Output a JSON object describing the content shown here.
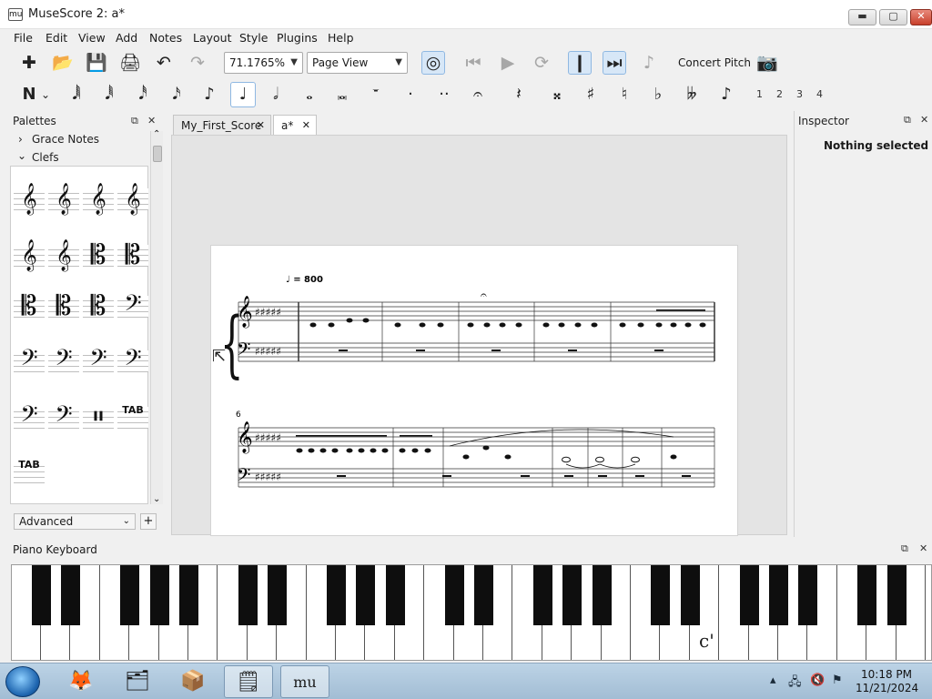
{
  "window": {
    "title": "MuseScore 2: a*",
    "app_icon": "mu",
    "controls": {
      "minimize": "▬",
      "maximize": "▢",
      "close": "✕"
    }
  },
  "menu": {
    "items": [
      "File",
      "Edit",
      "View",
      "Add",
      "Notes",
      "Layout",
      "Style",
      "Plugins",
      "Help"
    ]
  },
  "toolbar": {
    "zoom_value": "71.1765%",
    "view_mode": "Page View",
    "concert_pitch_label": "Concert Pitch",
    "icons": {
      "new_score": "✚",
      "open": "📂",
      "save": "💾",
      "print": "🖨",
      "undo": "↶",
      "redo": "↷",
      "midi_input": "◎",
      "rewind": "⏮",
      "play": "▶",
      "loop": "⟳",
      "play_repeats": "❙",
      "pan": "⏭",
      "metronome": "♪",
      "image_capture": "📷"
    }
  },
  "note_input": {
    "mode_icon": "N",
    "mode_arrow": "⌄",
    "durations": [
      "𝅘𝅥𝅲",
      "𝅘𝅥𝅱",
      "𝅘𝅥𝅰",
      "𝅘𝅥𝅯",
      "♪",
      "♩",
      "𝅗𝅥",
      "𝅝",
      "𝅜",
      "𝄻",
      "·",
      "··"
    ],
    "active_duration_index": 5,
    "extras": [
      "𝄐",
      "𝄽"
    ],
    "accidentals": [
      "𝄪",
      "♯",
      "♮",
      "♭",
      "𝄫",
      "♪"
    ],
    "voices": [
      "1",
      "2",
      "3",
      "4"
    ]
  },
  "palettes": {
    "title": "Palettes",
    "float": "⧉",
    "close": "✕",
    "sections": [
      {
        "label": "Grace Notes",
        "chevron": "›"
      },
      {
        "label": "Clefs",
        "chevron": "⌄"
      }
    ],
    "clefs": [
      "𝄞",
      "𝄞",
      "𝄞",
      "𝄞",
      "𝄞",
      "𝄞",
      "𝄡",
      "𝄡",
      "𝄡",
      "𝄡",
      "𝄡",
      "𝄢",
      "𝄢",
      "𝄢",
      "𝄢",
      "𝄢",
      "𝄢",
      "𝄢",
      "𝄥",
      "TAB",
      "TAB"
    ],
    "workspace": "Advanced",
    "add": "+",
    "scroll_up": "⌃",
    "scroll_down": "⌄"
  },
  "tabs": [
    {
      "label": "My_First_Score",
      "close": "✕"
    },
    {
      "label": "a*",
      "close": "✕"
    }
  ],
  "score": {
    "tempo_marking": "♩ = 800",
    "system2_measure_number": "6"
  },
  "inspector": {
    "title": "Inspector",
    "float": "⧉",
    "close": "✕",
    "status": "Nothing selected"
  },
  "piano": {
    "title": "Piano Keyboard",
    "float": "⧉",
    "close": "✕",
    "marker": "c'"
  },
  "taskbar": {
    "apps": [
      "🦊",
      "🗂",
      "📦",
      "🗒",
      "mu"
    ],
    "tray_icons": [
      "▴",
      "🖧",
      "🔇",
      "⚑"
    ],
    "time": "10:18 PM",
    "date": "11/21/2024"
  },
  "colors": {
    "accent": "#8fb8e2",
    "page": "#ffffff",
    "canvas": "#e4e4e4"
  }
}
